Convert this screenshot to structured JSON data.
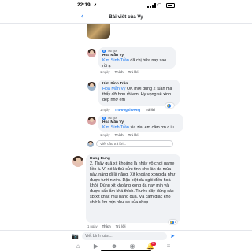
{
  "status_bar": {
    "time": "22:19",
    "location_icon": "arrow-icon",
    "signal": "cellular-bars",
    "wifi": "wifi-icon",
    "battery": "battery-icon"
  },
  "header": {
    "title": "Bài viết của Vy",
    "back_icon": "back-chevron-icon"
  },
  "comments": [
    {
      "author": "Hoa Mẫn Vy",
      "badge": "Tác giả",
      "mention": "Kim Sinh Trần",
      "text": " đã chị bữa nay sao rồi ạ",
      "time": "1 ngày",
      "like_label": "Thích",
      "reply_label": "Trả lời",
      "avatar_icon": "female-avatar"
    },
    {
      "author": "Kim Sinh Trần",
      "mention": "Hoa Mẫn Vy",
      "text": " OK mới dùng 2 tuần mà thấy đỡ hơn rồi em. Hy vọng sẽ xinh đẹp nhớ em",
      "time": "1 ngày",
      "reaction_label": "Thương thương",
      "reply_label": "Trả lời",
      "reaction_count": "1",
      "avatar_icon": "female-avatar"
    },
    {
      "author": "Hoa Mẫn Vy",
      "badge": "Tác giả",
      "mention": "Kim Sinh Trần",
      "text": " zia zia. em cảm ơn c iu",
      "time": "1 ngày",
      "like_label": "Thích",
      "reply_label": "Trả lời",
      "avatar_icon": "female-avatar"
    },
    {
      "author": "Dung Dung",
      "text": "2. Thấy quả xịt khoáng là nhảy vô chơi game liền à. Vì nó là thứ cửu tinh cho làn da mùa này, nắng di là nắng. Xịt khoáng xong da như được tưới nước. Đặc biệt da ngồi điều hoà khỏi. Dùng xịt khoáng xong da nay mịn và được cấp ẩm khá thích. Trước đây dùng các sp xịt khác mũi nặng quá. Và cảm giác khô chớ k êm mịn như sp của shop",
      "time": "1 ngày",
      "like_label": "Thích",
      "reply_label": "Trả lời",
      "reaction_count": "1",
      "avatar_icon": "female-avatar"
    }
  ],
  "reply_placeholder": "Viết câu trả lời...",
  "composer": {
    "placeholder": "Viết bình luận...",
    "camera_icon": "camera-icon",
    "send_icon": "send-icon"
  },
  "bottom_nav": [
    {
      "name": "home",
      "icon": "home-icon",
      "active": false
    },
    {
      "name": "watch",
      "icon": "video-icon",
      "active": false
    },
    {
      "name": "groups",
      "icon": "groups-icon",
      "active": false
    },
    {
      "name": "profile",
      "icon": "profile-icon",
      "active": false
    },
    {
      "name": "notifications",
      "icon": "bell-icon",
      "active": false,
      "badge": "9+"
    },
    {
      "name": "menu",
      "icon": "menu-icon",
      "active": false
    }
  ],
  "colors": {
    "accent": "#1877f2",
    "bubble": "#f0f2f5",
    "text": "#1c1e21",
    "muted": "#65676b"
  }
}
